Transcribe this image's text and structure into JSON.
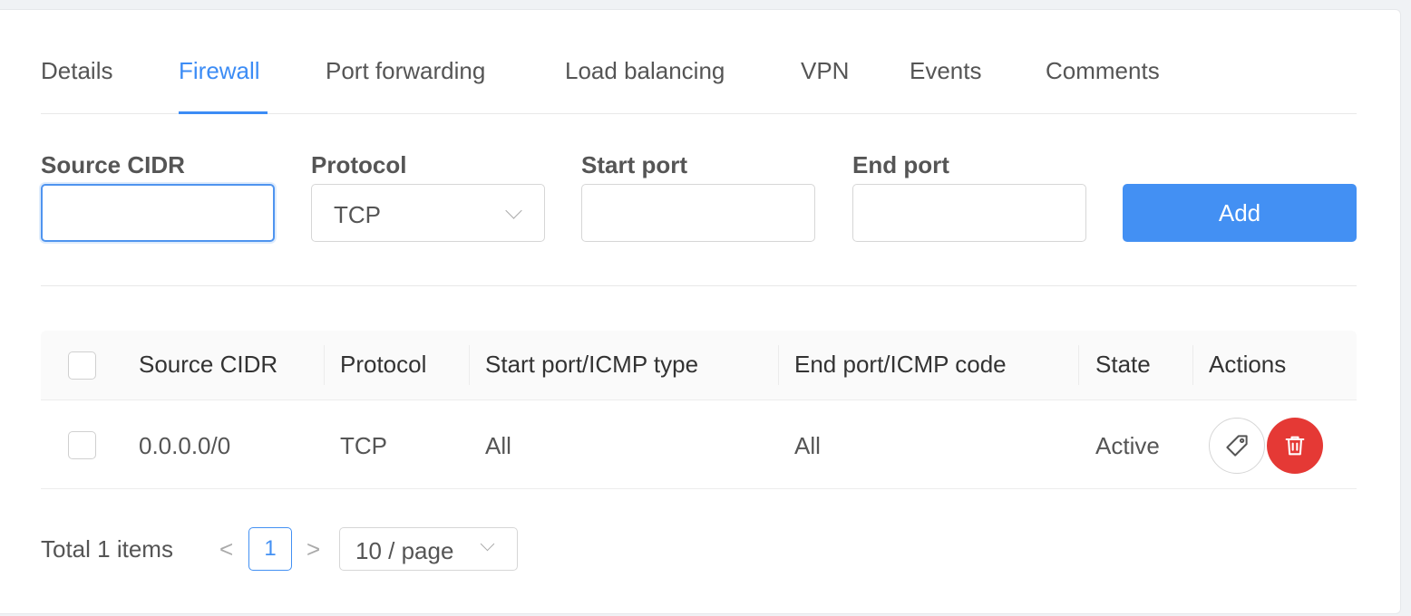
{
  "tabs": [
    {
      "label": "Details"
    },
    {
      "label": "Firewall"
    },
    {
      "label": "Port forwarding"
    },
    {
      "label": "Load balancing"
    },
    {
      "label": "VPN"
    },
    {
      "label": "Events"
    },
    {
      "label": "Comments"
    }
  ],
  "active_tab": "Firewall",
  "form": {
    "source_cidr_label": "Source CIDR",
    "source_cidr_value": "",
    "protocol_label": "Protocol",
    "protocol_value": "TCP",
    "start_port_label": "Start port",
    "start_port_value": "",
    "end_port_label": "End port",
    "end_port_value": "",
    "add_label": "Add"
  },
  "table": {
    "columns": [
      "Source CIDR",
      "Protocol",
      "Start port/ICMP type",
      "End port/ICMP code",
      "State",
      "Actions"
    ],
    "rows": [
      {
        "source_cidr": "0.0.0.0/0",
        "protocol": "TCP",
        "start_port": "All",
        "end_port": "All",
        "state": "Active",
        "actions": [
          "tag-icon",
          "trash-icon"
        ]
      }
    ]
  },
  "pagination": {
    "total_text": "Total 1 items",
    "prev": "<",
    "current_page": "1",
    "next": ">",
    "page_size": "10 / page"
  },
  "colors": {
    "accent": "#4390f3",
    "danger": "#e53935"
  }
}
